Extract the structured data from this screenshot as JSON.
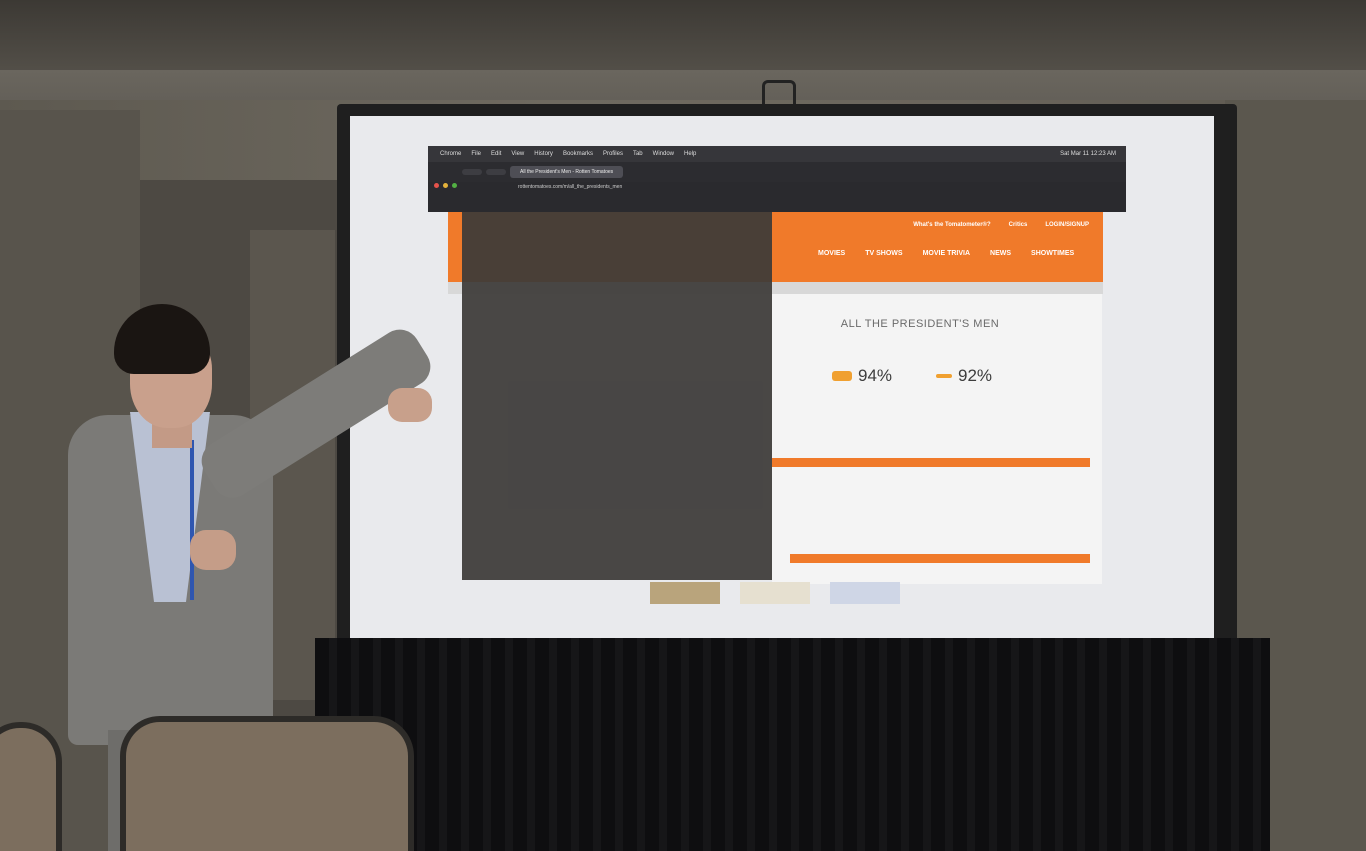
{
  "scene": {
    "description_tag": "presentation-room"
  },
  "browser": {
    "menu_items": [
      "Chrome",
      "File",
      "Edit",
      "View",
      "History",
      "Bookmarks",
      "Profiles",
      "Tab",
      "Window",
      "Help"
    ],
    "clock": "Sat Mar 11 12:23 AM",
    "tabs": [
      "",
      "",
      "All the President's Men - Rotten Tomatoes"
    ],
    "url": "rottentomatoes.com/m/all_the_presidents_men"
  },
  "page": {
    "top_links": [
      "What's the Tomatometer®?",
      "Critics",
      "LOGIN/SIGNUP"
    ],
    "nav": [
      "MOVIES",
      "TV SHOWS",
      "MOVIE TRIVIA",
      "NEWS",
      "SHOWTIMES"
    ],
    "movie_title": "ALL THE PRESIDENT'S MEN",
    "tomatometer": "94%",
    "audience_score": "92%"
  },
  "colors": {
    "accent": "#f07a2a",
    "screen": "#e9eaed"
  }
}
